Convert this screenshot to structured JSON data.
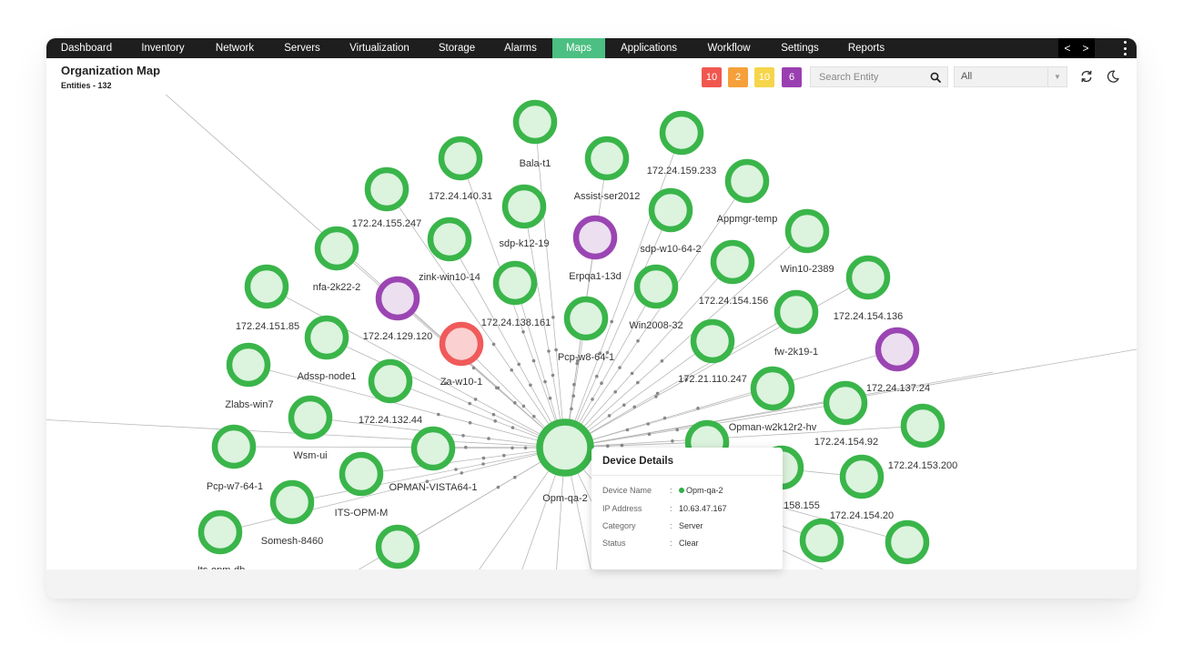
{
  "nav": {
    "tabs": [
      {
        "label": "Dashboard",
        "active": false
      },
      {
        "label": "Inventory",
        "active": false
      },
      {
        "label": "Network",
        "active": false
      },
      {
        "label": "Servers",
        "active": false
      },
      {
        "label": "Virtualization",
        "active": false
      },
      {
        "label": "Storage",
        "active": false
      },
      {
        "label": "Alarms",
        "active": false
      },
      {
        "label": "Maps",
        "active": true
      },
      {
        "label": "Applications",
        "active": false
      },
      {
        "label": "Workflow",
        "active": false
      },
      {
        "label": "Settings",
        "active": false
      },
      {
        "label": "Reports",
        "active": false
      }
    ],
    "prev_arrow": "<",
    "next_arrow": ">"
  },
  "header": {
    "title": "Organization Map",
    "subtitle": "Entities - 132",
    "badges": [
      {
        "value": "10",
        "color": "#f0574f"
      },
      {
        "value": "2",
        "color": "#f5a03a"
      },
      {
        "value": "10",
        "color": "#f6d54a"
      },
      {
        "value": "6",
        "color": "#9a3fb1"
      }
    ],
    "search_placeholder": "Search Entity",
    "filter_value": "All"
  },
  "colors": {
    "clear_stroke": "#3ab54a",
    "clear_fill": "#dcf3de",
    "critical_stroke": "#f05a5a",
    "critical_fill": "#fbd0d0",
    "attention_stroke": "#9b45b3",
    "attention_fill": "#ecdff0",
    "accent": "#4cbf82"
  },
  "map": {
    "center": {
      "label": "Opm-qa-2",
      "status": "clear"
    },
    "nodes": [
      {
        "label": "Bala-t1",
        "status": "clear"
      },
      {
        "label": "172.24.159.233",
        "status": "clear"
      },
      {
        "label": "172.24.140.31",
        "status": "clear"
      },
      {
        "label": "Assist-ser2012",
        "status": "clear"
      },
      {
        "label": "Appmgr-temp",
        "status": "clear"
      },
      {
        "label": "172.24.155.247",
        "status": "clear"
      },
      {
        "label": "sdp-k12-19",
        "status": "clear"
      },
      {
        "label": "Erpqa1-13d",
        "status": "attention"
      },
      {
        "label": "sdp-w10-64-2",
        "status": "clear"
      },
      {
        "label": "Win10-2389",
        "status": "clear"
      },
      {
        "label": "zink-win10-14",
        "status": "clear"
      },
      {
        "label": "nfa-2k22-2",
        "status": "clear"
      },
      {
        "label": "172.24.154.156",
        "status": "clear"
      },
      {
        "label": "172.24.154.136",
        "status": "clear"
      },
      {
        "label": "172.24.138.161",
        "status": "clear"
      },
      {
        "label": "Win2008-32",
        "status": "clear"
      },
      {
        "label": "172.24.151.85",
        "status": "clear"
      },
      {
        "label": "Adssp-node1",
        "status": "clear"
      },
      {
        "label": "Pcp-w8-64-1",
        "status": "clear"
      },
      {
        "label": "fw-2k19-1",
        "status": "clear"
      },
      {
        "label": "172.24.129.120",
        "status": "attention"
      },
      {
        "label": "Za-w10-1",
        "status": "critical"
      },
      {
        "label": "172.21.110.247",
        "status": "clear"
      },
      {
        "label": "172.24.137.24",
        "status": "attention"
      },
      {
        "label": "Zlabs-win7",
        "status": "clear"
      },
      {
        "label": "172.24.132.44",
        "status": "clear"
      },
      {
        "label": "Opman-w2k12r2-hv",
        "status": "clear"
      },
      {
        "label": "172.24.154.92",
        "status": "clear"
      },
      {
        "label": "Wsm-ui",
        "status": "clear"
      },
      {
        "label": "172.24.153.200",
        "status": "clear"
      },
      {
        "label": "Pcp-w7-64-1",
        "status": "clear"
      },
      {
        "label": "OPMAN-VISTA64-1",
        "status": "clear"
      },
      {
        "label": "ITS-OPM-M",
        "status": "clear"
      },
      {
        "label": "172.24.154.20",
        "status": "clear"
      },
      {
        "label": "Somesh-8460",
        "status": "clear"
      },
      {
        "label": "Its-opm-db",
        "status": "clear"
      },
      {
        "label": "158.155",
        "status": "clear"
      },
      {
        "label": "",
        "status": "clear"
      },
      {
        "label": "",
        "status": "clear"
      },
      {
        "label": "",
        "status": "clear"
      },
      {
        "label": "",
        "status": "clear"
      }
    ]
  },
  "device_details": {
    "title": "Device Details",
    "rows": [
      {
        "key": "Device Name",
        "value": "Opm-qa-2",
        "status_dot": true
      },
      {
        "key": "IP Address",
        "value": "10.63.47.167",
        "status_dot": false
      },
      {
        "key": "Category",
        "value": "Server",
        "status_dot": false
      },
      {
        "key": "Status",
        "value": "Clear",
        "status_dot": false
      }
    ]
  }
}
